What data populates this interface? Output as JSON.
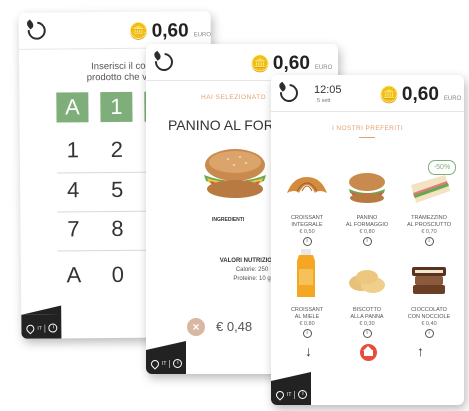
{
  "currency_label": "EURO",
  "screen1": {
    "credit": "0,60",
    "prompt_line1": "Inserisci il codice",
    "prompt_line2": "prodotto che vuoi e",
    "keys": [
      [
        "A",
        "1",
        ""
      ],
      [
        "1",
        "2",
        ""
      ],
      [
        "4",
        "5",
        ""
      ],
      [
        "7",
        "8",
        ""
      ],
      [
        "A",
        "0",
        ""
      ]
    ]
  },
  "screen2": {
    "credit": "0,60",
    "selected_label": "HAI SELEZIONATO",
    "product_title": "PANINO AL FORM",
    "ingredients_label": "INGREDIENTI",
    "nutrition_title": "VALORI NUTRIZIONAL",
    "calories": "Calorie: 250",
    "proteins": "Proteine: 10 g",
    "price": "€ 0,48",
    "cancel_icon": "×"
  },
  "screen3": {
    "time": "12:05",
    "date": "5 sett",
    "credit": "0,60",
    "favorites_title": "I NOSTRI PREFERITI",
    "discount_badge": "-50%",
    "products": [
      {
        "name_line1": "CROISSANT",
        "name_line2": "INTEGRALE",
        "price": "€ 0,50"
      },
      {
        "name_line1": "PANINO",
        "name_line2": "AL FORMAGGIO",
        "price": "€ 0,80"
      },
      {
        "name_line1": "TRAMEZZINO",
        "name_line2": "AL PROSCIUTTO",
        "price": "€ 0,70"
      },
      {
        "name_line1": "CROISSANT",
        "name_line2": "AL MIELE",
        "price": "€ 0,80"
      },
      {
        "name_line1": "BISCOTTO",
        "name_line2": "ALLA PANNA",
        "price": "€ 0,30"
      },
      {
        "name_line1": "CIOCCOLATO",
        "name_line2": "CON NOCCIOLE",
        "price": "€ 0,40"
      }
    ],
    "nav_down": "↓",
    "nav_up": "↑"
  },
  "footer": {
    "info_glyph": "i",
    "flag_text": "IT"
  },
  "colors": {
    "accent_green": "#7fae7a",
    "accent_orange": "#e4a06a",
    "home_red": "#e74c3c",
    "footer_dark": "#222222"
  }
}
